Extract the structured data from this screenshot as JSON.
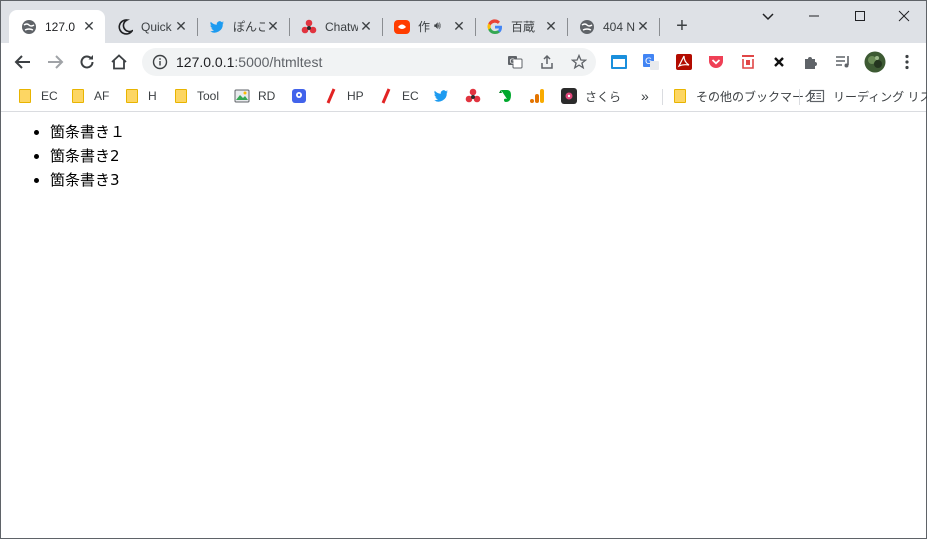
{
  "tabs": [
    {
      "title": "127.0",
      "active": true,
      "favicon": "globe-icon"
    },
    {
      "title": "Quick",
      "favicon": "moon-icon"
    },
    {
      "title": "ぽんこ",
      "favicon": "twitter-icon"
    },
    {
      "title": "Chatw",
      "favicon": "chatwork-icon"
    },
    {
      "title": "作",
      "favicon": "video-icon",
      "audio": true
    },
    {
      "title": "百蔵",
      "favicon": "google-icon"
    },
    {
      "title": "404 N",
      "favicon": "globe-icon"
    }
  ],
  "address": {
    "host": "127.0.0.1",
    "path": ":5000/htmltest"
  },
  "bookmarks": [
    {
      "label": "EC",
      "icon": "folder-icon"
    },
    {
      "label": "AF",
      "icon": "folder-icon"
    },
    {
      "label": "H",
      "icon": "folder-icon"
    },
    {
      "label": "Tool",
      "icon": "folder-icon"
    },
    {
      "label": "RD",
      "icon": "image-icon"
    },
    {
      "label": "",
      "icon": "map-icon"
    },
    {
      "label": "HP",
      "icon": "slash-icon"
    },
    {
      "label": "EC",
      "icon": "slash-icon"
    },
    {
      "label": "",
      "icon": "twitter-icon"
    },
    {
      "label": "",
      "icon": "chatwork-icon"
    },
    {
      "label": "",
      "icon": "evernote-icon"
    },
    {
      "label": "",
      "icon": "analytics-icon"
    },
    {
      "label": "さくら",
      "icon": "sakura-icon"
    }
  ],
  "bookmarks_overflow": "»",
  "other_bookmarks": "その他のブックマーク",
  "reading_list": "リーディング リスト",
  "page": {
    "list_items": [
      "箇条書き１",
      "箇条書き2",
      "箇条書き3"
    ]
  },
  "colors": {
    "tabstrip": "#dee1e6",
    "omnibox": "#f1f3f4"
  }
}
